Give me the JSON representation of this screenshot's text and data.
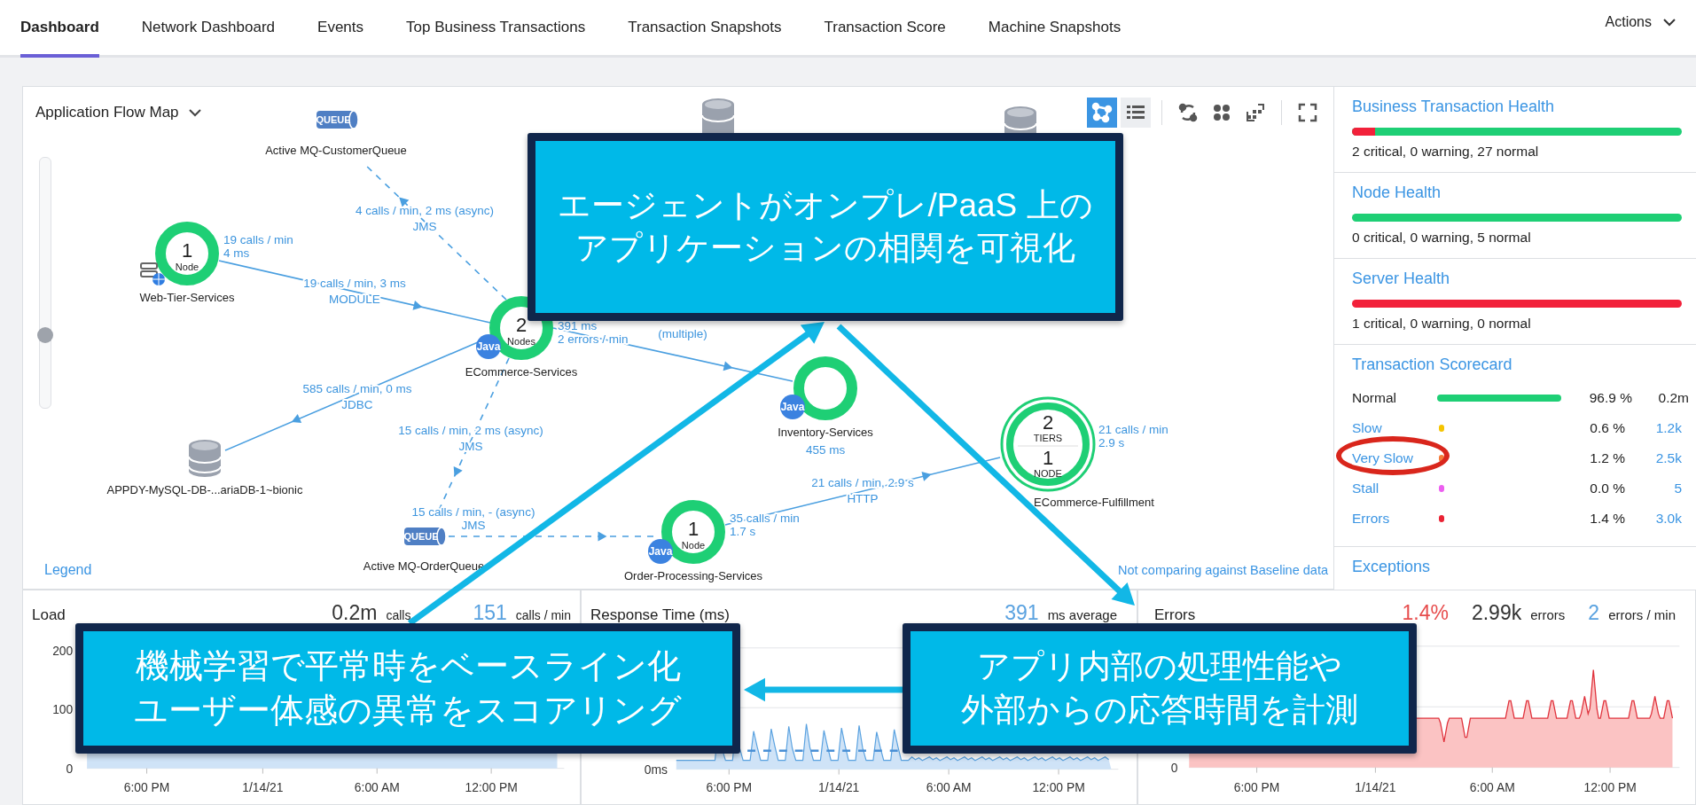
{
  "tabs": [
    {
      "label": "Dashboard",
      "selected": true
    },
    {
      "label": "Network Dashboard",
      "selected": false
    },
    {
      "label": "Events",
      "selected": false
    },
    {
      "label": "Top Business Transactions",
      "selected": false
    },
    {
      "label": "Transaction Snapshots",
      "selected": false
    },
    {
      "label": "Transaction Score",
      "selected": false
    },
    {
      "label": "Machine Snapshots",
      "selected": false
    }
  ],
  "actions": {
    "label": "Actions"
  },
  "flow_map": {
    "title": "Application Flow Map",
    "legend": "Legend",
    "baseline_note": "Not comparing against Baseline data",
    "zoom_slider": {
      "level": 0.29
    },
    "toolbar": [
      {
        "kind": "flow",
        "selected": true
      },
      {
        "kind": "list",
        "selected": false
      },
      {
        "kind": "sync",
        "selected": false
      },
      {
        "kind": "cluster",
        "selected": false
      },
      {
        "kind": "layout",
        "selected": false
      },
      {
        "kind": "fullscreen",
        "selected": false
      }
    ],
    "tiers": [
      {
        "name": "Web-Tier-Services",
        "kind": "node",
        "count": "1",
        "unit": "Node",
        "badge": {
          "kind": "web"
        },
        "stats": [
          "19 calls / min",
          "4 ms"
        ]
      },
      {
        "name": "ECommerce-Services",
        "kind": "node",
        "count": "2",
        "unit": "Nodes",
        "badge": {
          "kind": "java",
          "label": "Java"
        },
        "stats": [
          "391 ms",
          "2 errors / min"
        ]
      },
      {
        "name": "Inventory-Services",
        "kind": "node",
        "badge": {
          "kind": "java",
          "label": "Java"
        },
        "stats": [
          "455 ms"
        ]
      },
      {
        "name": "Order-Processing-Services",
        "kind": "node",
        "count": "1",
        "unit": "Node",
        "badge": {
          "kind": "java",
          "label": "Java"
        },
        "stats": [
          "35 calls / min",
          "1.7 s"
        ]
      },
      {
        "name": "ECommerce-Fulfillment",
        "kind": "group",
        "count": "2",
        "unit": "TIERS",
        "count_2": "1",
        "unit_2": "NODE",
        "stats": [
          "21 calls / min",
          "2.9 s"
        ]
      }
    ],
    "backends": [
      {
        "kind": "queue",
        "badge": "QUEUE",
        "name": "Active MQ-CustomerQueue"
      },
      {
        "kind": "database",
        "name": "APPDY-MySQL-DB-...ariaDB-1~bionic"
      },
      {
        "kind": "queue",
        "badge": "QUEUE",
        "name": "Active MQ-OrderQueue"
      },
      {
        "kind": "database"
      },
      {
        "kind": "database"
      }
    ],
    "edges": [
      {
        "lines": [
          "19 calls / min, 3 ms",
          "MODULE"
        ]
      },
      {
        "lines": [
          "4 calls / min, 2 ms (async)",
          "JMS"
        ]
      },
      {
        "lines": [
          "585 calls / min, 0 ms",
          "JDBC"
        ]
      },
      {
        "lines": [
          "15 calls / min, 2 ms (async)",
          "JMS"
        ]
      },
      {
        "lines": [
          "15 calls / min, - (async)",
          "JMS"
        ]
      },
      {
        "lines": [
          "21 calls / min, 2.9 s",
          "HTTP"
        ]
      },
      {
        "lines": [
          "(multiple)"
        ]
      }
    ]
  },
  "health": [
    {
      "title": "Business Transaction Health",
      "level": 0.07,
      "summary": "2 critical, 0 warning, 27 normal"
    },
    {
      "title": "Node Health",
      "level": 0,
      "summary": "0 critical, 0 warning, 5 normal"
    },
    {
      "title": "Server Health",
      "level": 1,
      "summary": "1 critical, 0 warning, 0 normal"
    }
  ],
  "scorecard": {
    "title": "Transaction Scorecard",
    "rows": [
      {
        "label": "Normal",
        "kind": "bar",
        "percent": "96.9 %",
        "count": "0.2m",
        "circled": false
      },
      {
        "label": "Slow",
        "kind": "dot",
        "color": "#f5c400",
        "percent": "0.6 %",
        "count": "1.2k",
        "circled": false
      },
      {
        "label": "Very Slow",
        "kind": "dot",
        "color": "#f47b3a",
        "percent": "1.2 %",
        "count": "2.5k",
        "circled": true
      },
      {
        "label": "Stall",
        "kind": "dot",
        "color": "#ec5ff0",
        "percent": "0.0 %",
        "count": "5",
        "circled": false
      },
      {
        "label": "Errors",
        "kind": "dot",
        "color": "#ea2233",
        "percent": "1.4 %",
        "count": "3.0k",
        "circled": false
      }
    ]
  },
  "exceptions": {
    "title": "Exceptions"
  },
  "charts": [
    {
      "kind": "load",
      "title": "Load",
      "stats": [
        {
          "value": "0.2m",
          "kind": "total",
          "unit": "calls"
        },
        {
          "value": "151",
          "kind": "rate",
          "unit": "calls / min"
        }
      ],
      "y_ticks": [
        "200",
        "100",
        "0"
      ],
      "x_ticks": [
        "6:00 PM",
        "1/14/21",
        "6:00 AM",
        "12:00 PM"
      ]
    },
    {
      "kind": "response",
      "title": "Response Time (ms)",
      "stats": [
        {
          "value": "391",
          "kind": "rate",
          "unit": "ms average"
        }
      ],
      "y_ticks": [
        "0ms"
      ],
      "x_ticks": [
        "6:00 PM",
        "1/14/21",
        "6:00 AM",
        "12:00 PM"
      ]
    },
    {
      "kind": "errors",
      "title": "Errors",
      "stats": [
        {
          "value": "1.4%",
          "kind": "ratio"
        },
        {
          "value": "2.99k",
          "kind": "total",
          "unit": "errors"
        },
        {
          "value": "2",
          "kind": "rate",
          "unit": "errors / min"
        }
      ],
      "y_ticks": [
        "0"
      ],
      "x_ticks": [
        "6:00 PM",
        "1/14/21",
        "6:00 AM",
        "12:00 PM"
      ]
    }
  ],
  "callouts": [
    {
      "lines": [
        "エージェントがオンプレ/PaaS 上の",
        "アプリケーションの相関を可視化"
      ]
    },
    {
      "lines": [
        "機械学習で平常時をベースライン化",
        "ユーザー体感の異常をスコアリング"
      ]
    },
    {
      "lines": [
        "アプリ内部の処理性能や",
        "外部からの応答時間を計測"
      ]
    }
  ]
}
